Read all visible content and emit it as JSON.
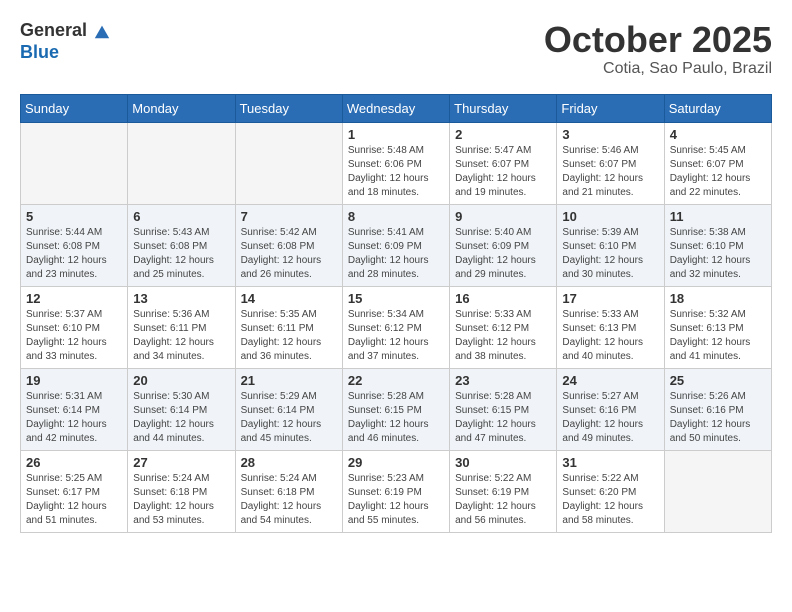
{
  "header": {
    "logo_line1": "General",
    "logo_line2": "Blue",
    "month": "October 2025",
    "location": "Cotia, Sao Paulo, Brazil"
  },
  "weekdays": [
    "Sunday",
    "Monday",
    "Tuesday",
    "Wednesday",
    "Thursday",
    "Friday",
    "Saturday"
  ],
  "weeks": [
    [
      {
        "day": "",
        "info": ""
      },
      {
        "day": "",
        "info": ""
      },
      {
        "day": "",
        "info": ""
      },
      {
        "day": "1",
        "info": "Sunrise: 5:48 AM\nSunset: 6:06 PM\nDaylight: 12 hours\nand 18 minutes."
      },
      {
        "day": "2",
        "info": "Sunrise: 5:47 AM\nSunset: 6:07 PM\nDaylight: 12 hours\nand 19 minutes."
      },
      {
        "day": "3",
        "info": "Sunrise: 5:46 AM\nSunset: 6:07 PM\nDaylight: 12 hours\nand 21 minutes."
      },
      {
        "day": "4",
        "info": "Sunrise: 5:45 AM\nSunset: 6:07 PM\nDaylight: 12 hours\nand 22 minutes."
      }
    ],
    [
      {
        "day": "5",
        "info": "Sunrise: 5:44 AM\nSunset: 6:08 PM\nDaylight: 12 hours\nand 23 minutes."
      },
      {
        "day": "6",
        "info": "Sunrise: 5:43 AM\nSunset: 6:08 PM\nDaylight: 12 hours\nand 25 minutes."
      },
      {
        "day": "7",
        "info": "Sunrise: 5:42 AM\nSunset: 6:08 PM\nDaylight: 12 hours\nand 26 minutes."
      },
      {
        "day": "8",
        "info": "Sunrise: 5:41 AM\nSunset: 6:09 PM\nDaylight: 12 hours\nand 28 minutes."
      },
      {
        "day": "9",
        "info": "Sunrise: 5:40 AM\nSunset: 6:09 PM\nDaylight: 12 hours\nand 29 minutes."
      },
      {
        "day": "10",
        "info": "Sunrise: 5:39 AM\nSunset: 6:10 PM\nDaylight: 12 hours\nand 30 minutes."
      },
      {
        "day": "11",
        "info": "Sunrise: 5:38 AM\nSunset: 6:10 PM\nDaylight: 12 hours\nand 32 minutes."
      }
    ],
    [
      {
        "day": "12",
        "info": "Sunrise: 5:37 AM\nSunset: 6:10 PM\nDaylight: 12 hours\nand 33 minutes."
      },
      {
        "day": "13",
        "info": "Sunrise: 5:36 AM\nSunset: 6:11 PM\nDaylight: 12 hours\nand 34 minutes."
      },
      {
        "day": "14",
        "info": "Sunrise: 5:35 AM\nSunset: 6:11 PM\nDaylight: 12 hours\nand 36 minutes."
      },
      {
        "day": "15",
        "info": "Sunrise: 5:34 AM\nSunset: 6:12 PM\nDaylight: 12 hours\nand 37 minutes."
      },
      {
        "day": "16",
        "info": "Sunrise: 5:33 AM\nSunset: 6:12 PM\nDaylight: 12 hours\nand 38 minutes."
      },
      {
        "day": "17",
        "info": "Sunrise: 5:33 AM\nSunset: 6:13 PM\nDaylight: 12 hours\nand 40 minutes."
      },
      {
        "day": "18",
        "info": "Sunrise: 5:32 AM\nSunset: 6:13 PM\nDaylight: 12 hours\nand 41 minutes."
      }
    ],
    [
      {
        "day": "19",
        "info": "Sunrise: 5:31 AM\nSunset: 6:14 PM\nDaylight: 12 hours\nand 42 minutes."
      },
      {
        "day": "20",
        "info": "Sunrise: 5:30 AM\nSunset: 6:14 PM\nDaylight: 12 hours\nand 44 minutes."
      },
      {
        "day": "21",
        "info": "Sunrise: 5:29 AM\nSunset: 6:14 PM\nDaylight: 12 hours\nand 45 minutes."
      },
      {
        "day": "22",
        "info": "Sunrise: 5:28 AM\nSunset: 6:15 PM\nDaylight: 12 hours\nand 46 minutes."
      },
      {
        "day": "23",
        "info": "Sunrise: 5:28 AM\nSunset: 6:15 PM\nDaylight: 12 hours\nand 47 minutes."
      },
      {
        "day": "24",
        "info": "Sunrise: 5:27 AM\nSunset: 6:16 PM\nDaylight: 12 hours\nand 49 minutes."
      },
      {
        "day": "25",
        "info": "Sunrise: 5:26 AM\nSunset: 6:16 PM\nDaylight: 12 hours\nand 50 minutes."
      }
    ],
    [
      {
        "day": "26",
        "info": "Sunrise: 5:25 AM\nSunset: 6:17 PM\nDaylight: 12 hours\nand 51 minutes."
      },
      {
        "day": "27",
        "info": "Sunrise: 5:24 AM\nSunset: 6:18 PM\nDaylight: 12 hours\nand 53 minutes."
      },
      {
        "day": "28",
        "info": "Sunrise: 5:24 AM\nSunset: 6:18 PM\nDaylight: 12 hours\nand 54 minutes."
      },
      {
        "day": "29",
        "info": "Sunrise: 5:23 AM\nSunset: 6:19 PM\nDaylight: 12 hours\nand 55 minutes."
      },
      {
        "day": "30",
        "info": "Sunrise: 5:22 AM\nSunset: 6:19 PM\nDaylight: 12 hours\nand 56 minutes."
      },
      {
        "day": "31",
        "info": "Sunrise: 5:22 AM\nSunset: 6:20 PM\nDaylight: 12 hours\nand 58 minutes."
      },
      {
        "day": "",
        "info": ""
      }
    ]
  ]
}
